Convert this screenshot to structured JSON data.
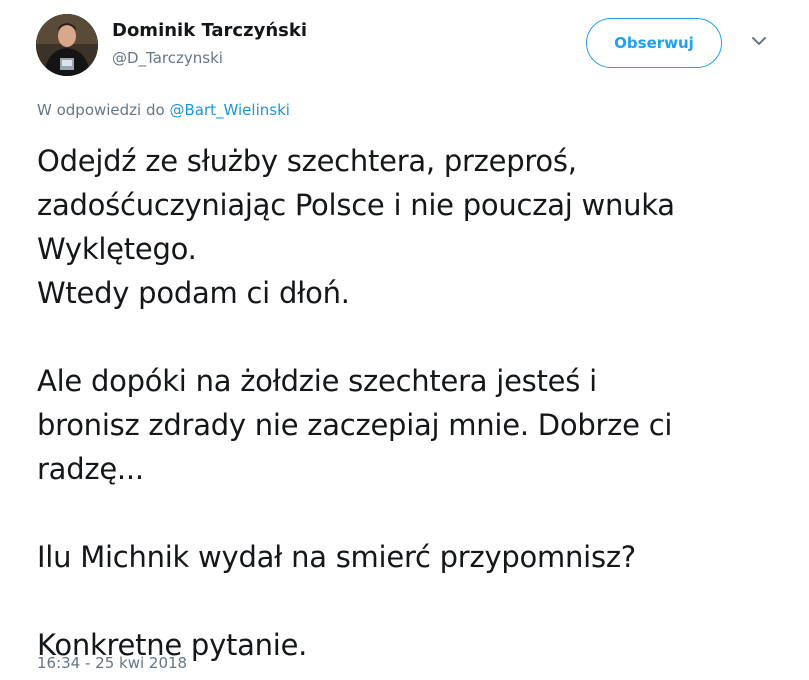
{
  "author": {
    "display_name": "Dominik Tarczyński",
    "handle": "@D_Tarczynski"
  },
  "follow_button": {
    "label": "Obserwuj"
  },
  "menu": {
    "icon": "chevron-down-icon"
  },
  "reply_context": {
    "prefix": "W odpowiedzi do",
    "mention": "@Bart_Wielinski"
  },
  "tweet_lines": [
    "Odejdź ze służby szechtera, przeproś,",
    "zadośćuczyniając Polsce i nie pouczaj wnuka",
    "Wyklętego.",
    "Wtedy podam ci dłoń.",
    "",
    "Ale dopóki na żołdzie szechtera jesteś i",
    "bronisz zdrady nie zaczepiaj mnie. Dobrze ci",
    "radzę...",
    "",
    "Ilu Michnik wydał na smierć przypomnisz?",
    "",
    "Konkretne pytanie."
  ],
  "timestamp": "16:34 - 25 kwi 2018",
  "colors": {
    "accent": "#1da1f2",
    "link": "#1b95e0",
    "secondary_text": "#657786",
    "primary_text": "#14171a"
  }
}
